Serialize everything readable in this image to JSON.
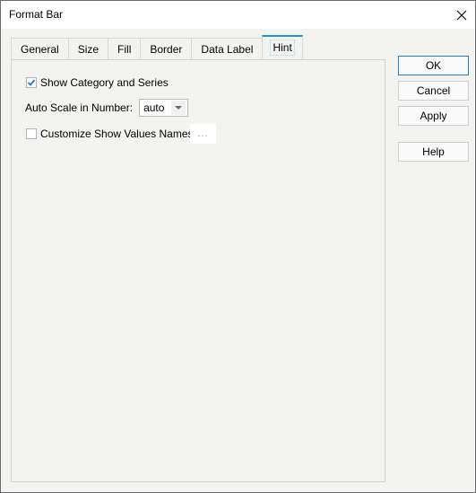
{
  "window": {
    "title": "Format Bar",
    "close_icon": "close-x-icon"
  },
  "tabs": [
    {
      "label": "General",
      "active": false
    },
    {
      "label": "Size",
      "active": false
    },
    {
      "label": "Fill",
      "active": false
    },
    {
      "label": "Border",
      "active": false
    },
    {
      "label": "Data Label",
      "active": false
    },
    {
      "label": "Hint",
      "active": true
    }
  ],
  "hint_panel": {
    "show_category_series": {
      "label": "Show Category and Series",
      "checked": true
    },
    "auto_scale": {
      "label": "Auto Scale in Number:",
      "value": "auto"
    },
    "customize_names": {
      "label": "Customize Show Values Names",
      "checked": false
    },
    "ellipsis_label": "..."
  },
  "buttons": {
    "ok": "OK",
    "cancel": "Cancel",
    "apply": "Apply",
    "help": "Help"
  },
  "colors": {
    "accent": "#1c97d8",
    "check": "#1a7fd0"
  }
}
